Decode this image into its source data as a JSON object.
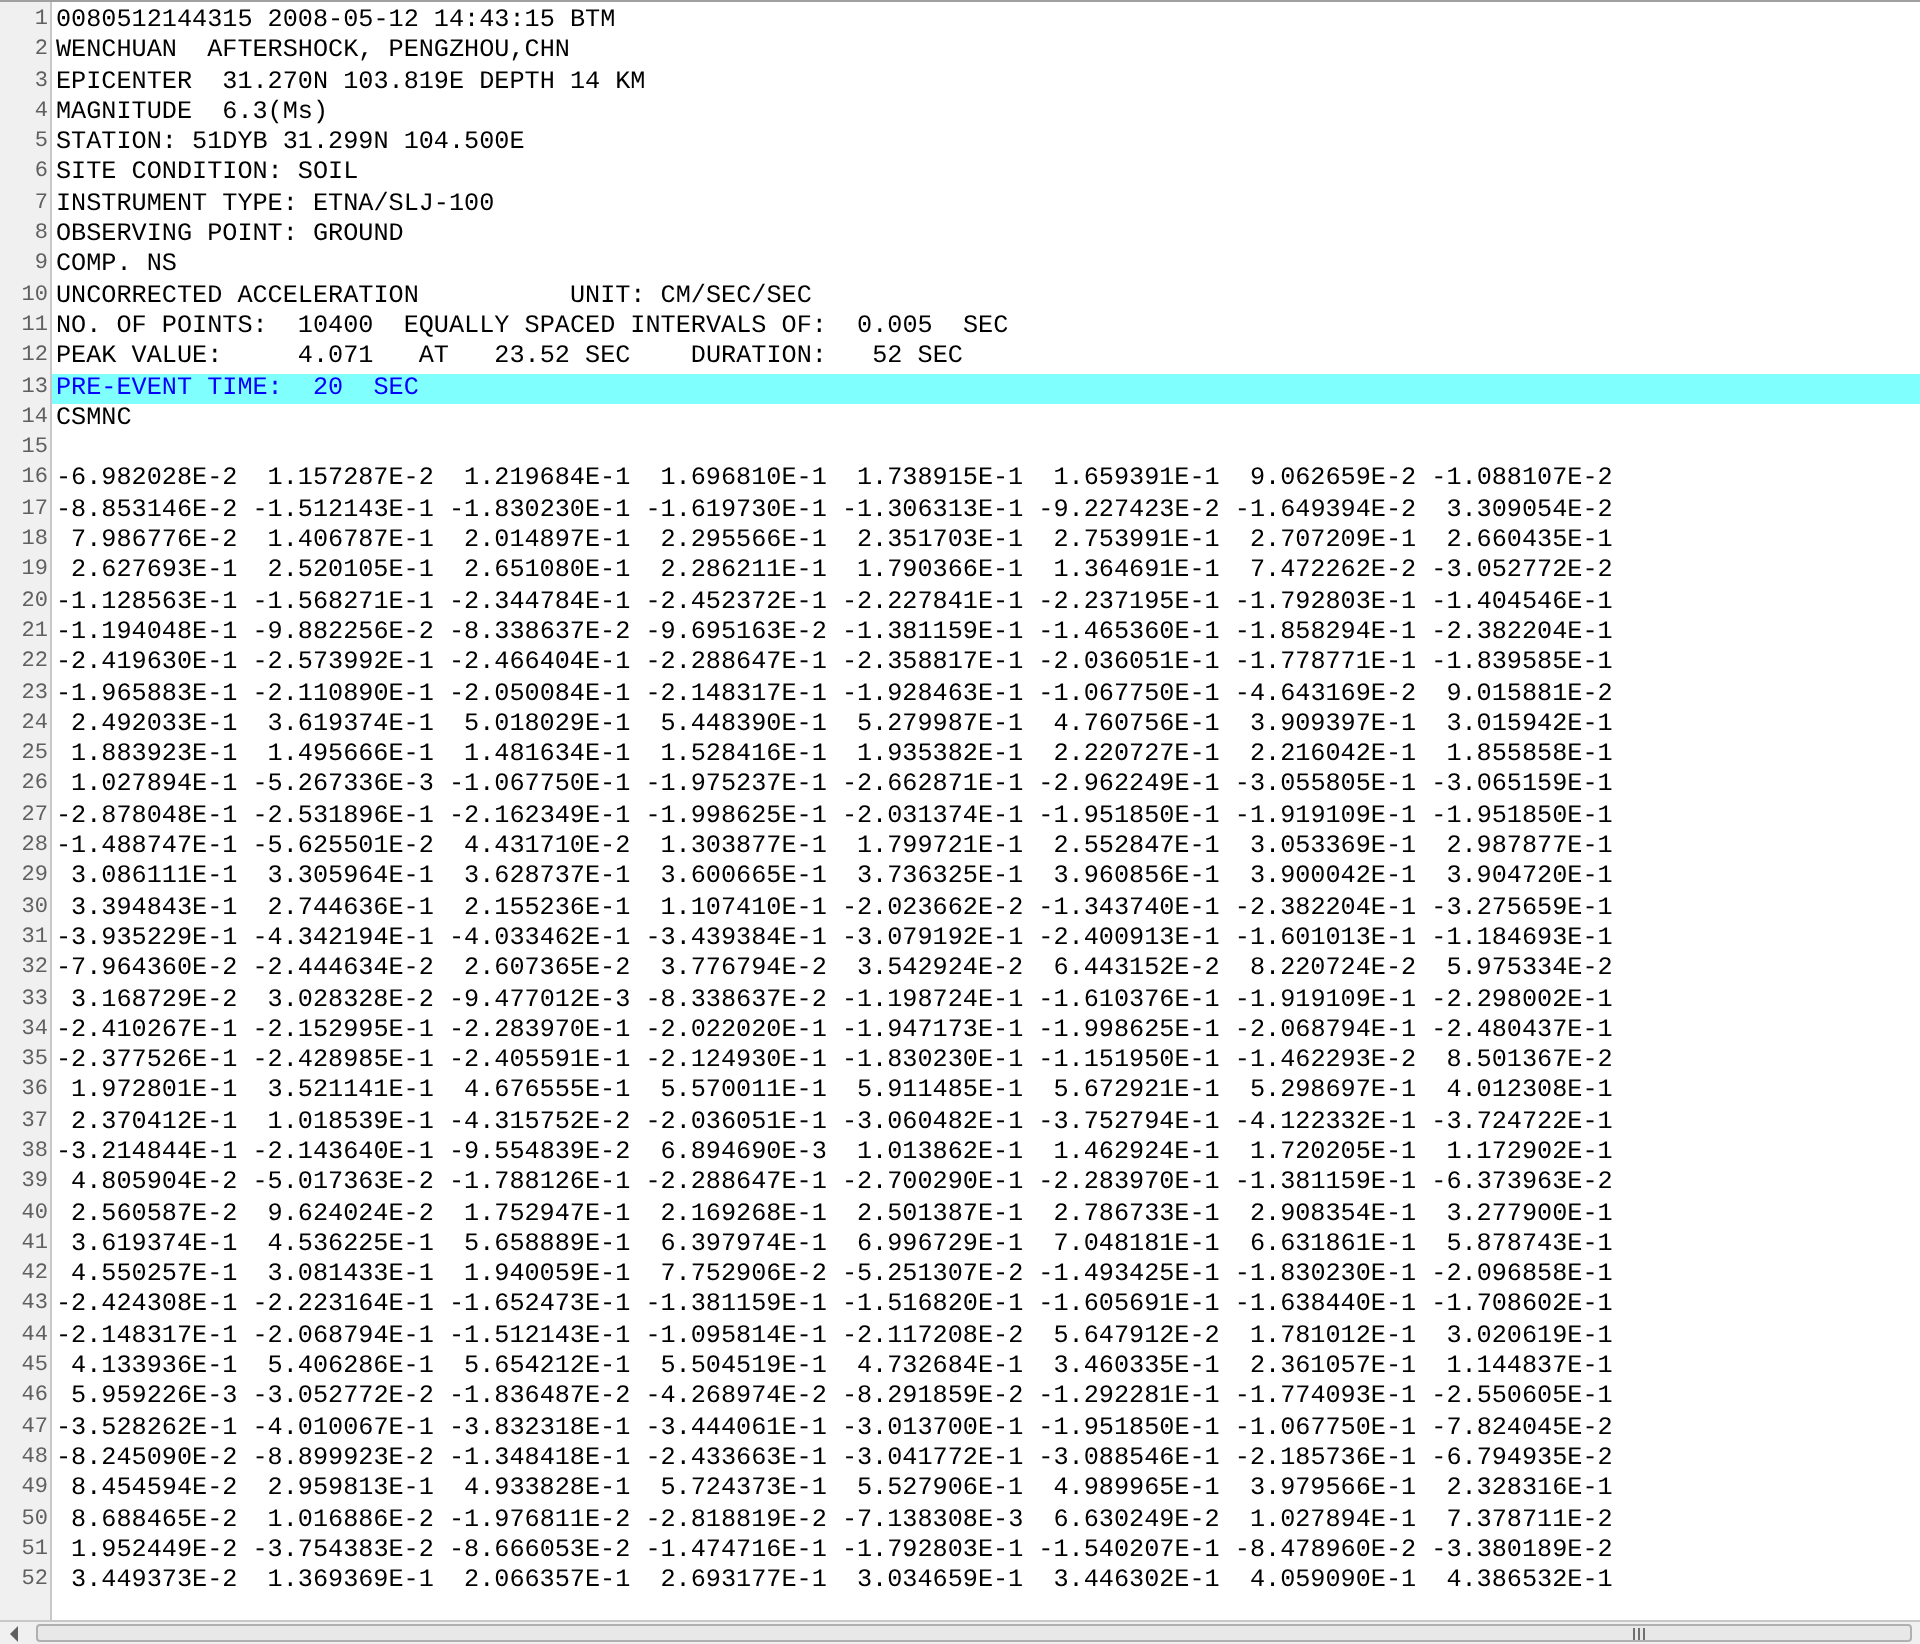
{
  "editor": {
    "lines": [
      {
        "number": "1",
        "kind": "text",
        "selected": false,
        "text": "0080512144315 2008-05-12 14:43:15 BTM"
      },
      {
        "number": "2",
        "kind": "text",
        "selected": false,
        "text": "WENCHUAN  AFTERSHOCK, PENGZHOU,CHN"
      },
      {
        "number": "3",
        "kind": "text",
        "selected": false,
        "text": "EPICENTER  31.270N 103.819E DEPTH 14 KM"
      },
      {
        "number": "4",
        "kind": "text",
        "selected": false,
        "text": "MAGNITUDE  6.3(Ms)"
      },
      {
        "number": "5",
        "kind": "text",
        "selected": false,
        "text": "STATION: 51DYB 31.299N 104.500E"
      },
      {
        "number": "6",
        "kind": "text",
        "selected": false,
        "text": "SITE CONDITION: SOIL"
      },
      {
        "number": "7",
        "kind": "text",
        "selected": false,
        "text": "INSTRUMENT TYPE: ETNA/SLJ-100"
      },
      {
        "number": "8",
        "kind": "text",
        "selected": false,
        "text": "OBSERVING POINT: GROUND"
      },
      {
        "number": "9",
        "kind": "text",
        "selected": false,
        "text": "COMP. NS"
      },
      {
        "number": "10",
        "kind": "text",
        "selected": false,
        "text": "UNCORRECTED ACCELERATION          UNIT: CM/SEC/SEC"
      },
      {
        "number": "11",
        "kind": "text",
        "selected": false,
        "text": "NO. OF POINTS:  10400  EQUALLY SPACED INTERVALS OF:  0.005  SEC"
      },
      {
        "number": "12",
        "kind": "text",
        "selected": false,
        "text": "PEAK VALUE:     4.071   AT   23.52 SEC    DURATION:   52 SEC"
      },
      {
        "number": "13",
        "kind": "text",
        "selected": true,
        "text": "PRE-EVENT TIME:  20  SEC"
      },
      {
        "number": "14",
        "kind": "text",
        "selected": false,
        "text": "CSMNC"
      },
      {
        "number": "15",
        "kind": "blank",
        "selected": false
      },
      {
        "number": "16",
        "kind": "data",
        "selected": false,
        "values": [
          "-6.982028E-2",
          "1.157287E-2",
          "1.219684E-1",
          "1.696810E-1",
          "1.738915E-1",
          "1.659391E-1",
          "9.062659E-2",
          "-1.088107E-2"
        ]
      },
      {
        "number": "17",
        "kind": "data",
        "selected": false,
        "values": [
          "-8.853146E-2",
          "-1.512143E-1",
          "-1.830230E-1",
          "-1.619730E-1",
          "-1.306313E-1",
          "-9.227423E-2",
          "-1.649394E-2",
          "3.309054E-2"
        ]
      },
      {
        "number": "18",
        "kind": "data",
        "selected": false,
        "values": [
          "7.986776E-2",
          "1.406787E-1",
          "2.014897E-1",
          "2.295566E-1",
          "2.351703E-1",
          "2.753991E-1",
          "2.707209E-1",
          "2.660435E-1"
        ]
      },
      {
        "number": "19",
        "kind": "data",
        "selected": false,
        "values": [
          "2.627693E-1",
          "2.520105E-1",
          "2.651080E-1",
          "2.286211E-1",
          "1.790366E-1",
          "1.364691E-1",
          "7.472262E-2",
          "-3.052772E-2"
        ]
      },
      {
        "number": "20",
        "kind": "data",
        "selected": false,
        "values": [
          "-1.128563E-1",
          "-1.568271E-1",
          "-2.344784E-1",
          "-2.452372E-1",
          "-2.227841E-1",
          "-2.237195E-1",
          "-1.792803E-1",
          "-1.404546E-1"
        ]
      },
      {
        "number": "21",
        "kind": "data",
        "selected": false,
        "values": [
          "-1.194048E-1",
          "-9.882256E-2",
          "-8.338637E-2",
          "-9.695163E-2",
          "-1.381159E-1",
          "-1.465360E-1",
          "-1.858294E-1",
          "-2.382204E-1"
        ]
      },
      {
        "number": "22",
        "kind": "data",
        "selected": false,
        "values": [
          "-2.419630E-1",
          "-2.573992E-1",
          "-2.466404E-1",
          "-2.288647E-1",
          "-2.358817E-1",
          "-2.036051E-1",
          "-1.778771E-1",
          "-1.839585E-1"
        ]
      },
      {
        "number": "23",
        "kind": "data",
        "selected": false,
        "values": [
          "-1.965883E-1",
          "-2.110890E-1",
          "-2.050084E-1",
          "-2.148317E-1",
          "-1.928463E-1",
          "-1.067750E-1",
          "-4.643169E-2",
          "9.015881E-2"
        ]
      },
      {
        "number": "24",
        "kind": "data",
        "selected": false,
        "values": [
          "2.492033E-1",
          "3.619374E-1",
          "5.018029E-1",
          "5.448390E-1",
          "5.279987E-1",
          "4.760756E-1",
          "3.909397E-1",
          "3.015942E-1"
        ]
      },
      {
        "number": "25",
        "kind": "data",
        "selected": false,
        "values": [
          "1.883923E-1",
          "1.495666E-1",
          "1.481634E-1",
          "1.528416E-1",
          "1.935382E-1",
          "2.220727E-1",
          "2.216042E-1",
          "1.855858E-1"
        ]
      },
      {
        "number": "26",
        "kind": "data",
        "selected": false,
        "values": [
          "1.027894E-1",
          "-5.267336E-3",
          "-1.067750E-1",
          "-1.975237E-1",
          "-2.662871E-1",
          "-2.962249E-1",
          "-3.055805E-1",
          "-3.065159E-1"
        ]
      },
      {
        "number": "27",
        "kind": "data",
        "selected": false,
        "values": [
          "-2.878048E-1",
          "-2.531896E-1",
          "-2.162349E-1",
          "-1.998625E-1",
          "-2.031374E-1",
          "-1.951850E-1",
          "-1.919109E-1",
          "-1.951850E-1"
        ]
      },
      {
        "number": "28",
        "kind": "data",
        "selected": false,
        "values": [
          "-1.488747E-1",
          "-5.625501E-2",
          "4.431710E-2",
          "1.303877E-1",
          "1.799721E-1",
          "2.552847E-1",
          "3.053369E-1",
          "2.987877E-1"
        ]
      },
      {
        "number": "29",
        "kind": "data",
        "selected": false,
        "values": [
          "3.086111E-1",
          "3.305964E-1",
          "3.628737E-1",
          "3.600665E-1",
          "3.736325E-1",
          "3.960856E-1",
          "3.900042E-1",
          "3.904720E-1"
        ]
      },
      {
        "number": "30",
        "kind": "data",
        "selected": false,
        "values": [
          "3.394843E-1",
          "2.744636E-1",
          "2.155236E-1",
          "1.107410E-1",
          "-2.023662E-2",
          "-1.343740E-1",
          "-2.382204E-1",
          "-3.275659E-1"
        ]
      },
      {
        "number": "31",
        "kind": "data",
        "selected": false,
        "values": [
          "-3.935229E-1",
          "-4.342194E-1",
          "-4.033462E-1",
          "-3.439384E-1",
          "-3.079192E-1",
          "-2.400913E-1",
          "-1.601013E-1",
          "-1.184693E-1"
        ]
      },
      {
        "number": "32",
        "kind": "data",
        "selected": false,
        "values": [
          "-7.964360E-2",
          "-2.444634E-2",
          "2.607365E-2",
          "3.776794E-2",
          "3.542924E-2",
          "6.443152E-2",
          "8.220724E-2",
          "5.975334E-2"
        ]
      },
      {
        "number": "33",
        "kind": "data",
        "selected": false,
        "values": [
          "3.168729E-2",
          "3.028328E-2",
          "-9.477012E-3",
          "-8.338637E-2",
          "-1.198724E-1",
          "-1.610376E-1",
          "-1.919109E-1",
          "-2.298002E-1"
        ]
      },
      {
        "number": "34",
        "kind": "data",
        "selected": false,
        "values": [
          "-2.410267E-1",
          "-2.152995E-1",
          "-2.283970E-1",
          "-2.022020E-1",
          "-1.947173E-1",
          "-1.998625E-1",
          "-2.068794E-1",
          "-2.480437E-1"
        ]
      },
      {
        "number": "35",
        "kind": "data",
        "selected": false,
        "values": [
          "-2.377526E-1",
          "-2.428985E-1",
          "-2.405591E-1",
          "-2.124930E-1",
          "-1.830230E-1",
          "-1.151950E-1",
          "-1.462293E-2",
          "8.501367E-2"
        ]
      },
      {
        "number": "36",
        "kind": "data",
        "selected": false,
        "values": [
          "1.972801E-1",
          "3.521141E-1",
          "4.676555E-1",
          "5.570011E-1",
          "5.911485E-1",
          "5.672921E-1",
          "5.298697E-1",
          "4.012308E-1"
        ]
      },
      {
        "number": "37",
        "kind": "data",
        "selected": false,
        "values": [
          "2.370412E-1",
          "1.018539E-1",
          "-4.315752E-2",
          "-2.036051E-1",
          "-3.060482E-1",
          "-3.752794E-1",
          "-4.122332E-1",
          "-3.724722E-1"
        ]
      },
      {
        "number": "38",
        "kind": "data",
        "selected": false,
        "values": [
          "-3.214844E-1",
          "-2.143640E-1",
          "-9.554839E-2",
          "6.894690E-3",
          "1.013862E-1",
          "1.462924E-1",
          "1.720205E-1",
          "1.172902E-1"
        ]
      },
      {
        "number": "39",
        "kind": "data",
        "selected": false,
        "values": [
          "4.805904E-2",
          "-5.017363E-2",
          "-1.788126E-1",
          "-2.288647E-1",
          "-2.700290E-1",
          "-2.283970E-1",
          "-1.381159E-1",
          "-6.373963E-2"
        ]
      },
      {
        "number": "40",
        "kind": "data",
        "selected": false,
        "values": [
          "2.560587E-2",
          "9.624024E-2",
          "1.752947E-1",
          "2.169268E-1",
          "2.501387E-1",
          "2.786733E-1",
          "2.908354E-1",
          "3.277900E-1"
        ]
      },
      {
        "number": "41",
        "kind": "data",
        "selected": false,
        "values": [
          "3.619374E-1",
          "4.536225E-1",
          "5.658889E-1",
          "6.397974E-1",
          "6.996729E-1",
          "7.048181E-1",
          "6.631861E-1",
          "5.878743E-1"
        ]
      },
      {
        "number": "42",
        "kind": "data",
        "selected": false,
        "values": [
          "4.550257E-1",
          "3.081433E-1",
          "1.940059E-1",
          "7.752906E-2",
          "-5.251307E-2",
          "-1.493425E-1",
          "-1.830230E-1",
          "-2.096858E-1"
        ]
      },
      {
        "number": "43",
        "kind": "data",
        "selected": false,
        "values": [
          "-2.424308E-1",
          "-2.223164E-1",
          "-1.652473E-1",
          "-1.381159E-1",
          "-1.516820E-1",
          "-1.605691E-1",
          "-1.638440E-1",
          "-1.708602E-1"
        ]
      },
      {
        "number": "44",
        "kind": "data",
        "selected": false,
        "values": [
          "-2.148317E-1",
          "-2.068794E-1",
          "-1.512143E-1",
          "-1.095814E-1",
          "-2.117208E-2",
          "5.647912E-2",
          "1.781012E-1",
          "3.020619E-1"
        ]
      },
      {
        "number": "45",
        "kind": "data",
        "selected": false,
        "values": [
          "4.133936E-1",
          "5.406286E-1",
          "5.654212E-1",
          "5.504519E-1",
          "4.732684E-1",
          "3.460335E-1",
          "2.361057E-1",
          "1.144837E-1"
        ]
      },
      {
        "number": "46",
        "kind": "data",
        "selected": false,
        "values": [
          "5.959226E-3",
          "-3.052772E-2",
          "-1.836487E-2",
          "-4.268974E-2",
          "-8.291859E-2",
          "-1.292281E-1",
          "-1.774093E-1",
          "-2.550605E-1"
        ]
      },
      {
        "number": "47",
        "kind": "data",
        "selected": false,
        "values": [
          "-3.528262E-1",
          "-4.010067E-1",
          "-3.832318E-1",
          "-3.444061E-1",
          "-3.013700E-1",
          "-1.951850E-1",
          "-1.067750E-1",
          "-7.824045E-2"
        ]
      },
      {
        "number": "48",
        "kind": "data",
        "selected": false,
        "values": [
          "-8.245090E-2",
          "-8.899923E-2",
          "-1.348418E-1",
          "-2.433663E-1",
          "-3.041772E-1",
          "-3.088546E-1",
          "-2.185736E-1",
          "-6.794935E-2"
        ]
      },
      {
        "number": "49",
        "kind": "data",
        "selected": false,
        "values": [
          "8.454594E-2",
          "2.959813E-1",
          "4.933828E-1",
          "5.724373E-1",
          "5.527906E-1",
          "4.989965E-1",
          "3.979566E-1",
          "2.328316E-1"
        ]
      },
      {
        "number": "50",
        "kind": "data",
        "selected": false,
        "values": [
          "8.688465E-2",
          "1.016886E-2",
          "-1.976811E-2",
          "-2.818819E-2",
          "-7.138308E-3",
          "6.630249E-2",
          "1.027894E-1",
          "7.378711E-2"
        ]
      },
      {
        "number": "51",
        "kind": "data",
        "selected": false,
        "values": [
          "1.952449E-2",
          "-3.754383E-2",
          "-8.666053E-2",
          "-1.474716E-1",
          "-1.792803E-1",
          "-1.540207E-1",
          "-8.478960E-2",
          "-3.380189E-2"
        ]
      },
      {
        "number": "52",
        "kind": "data",
        "selected": false,
        "values": [
          "3.449373E-2",
          "1.369369E-1",
          "2.066357E-1",
          "2.693177E-1",
          "3.034659E-1",
          "3.446302E-1",
          "4.059090E-1",
          "4.386532E-1"
        ]
      }
    ]
  }
}
